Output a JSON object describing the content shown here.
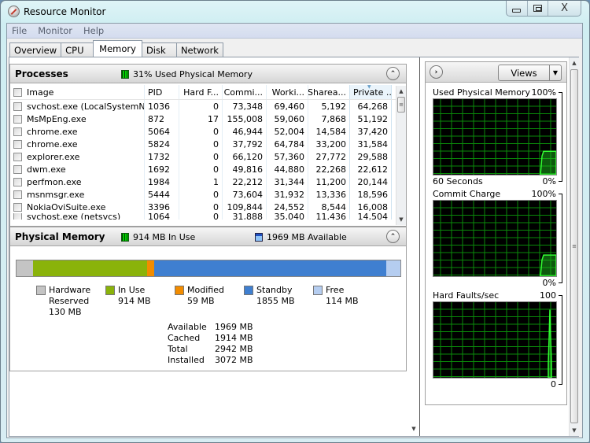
{
  "window": {
    "title": "Resource Monitor",
    "caption": {
      "minimize": "minimize",
      "maximize": "maximize",
      "close": "X"
    }
  },
  "menu": [
    "File",
    "Monitor",
    "Help"
  ],
  "tabs": [
    {
      "label": "Overview",
      "active": false
    },
    {
      "label": "CPU",
      "active": false
    },
    {
      "label": "Memory",
      "active": true
    },
    {
      "label": "Disk",
      "active": false
    },
    {
      "label": "Network",
      "active": false
    }
  ],
  "processes": {
    "title": "Processes",
    "indicator": "31% Used Physical Memory",
    "indicator_color": "#00d000",
    "columns": [
      "Image",
      "PID",
      "Hard F...",
      "Commi...",
      "Worki...",
      "Sharea...",
      "Private ..."
    ],
    "rows": [
      [
        "svchost.exe (LocalSystemNet...",
        "1036",
        "0",
        "73,348",
        "69,460",
        "5,192",
        "64,268"
      ],
      [
        "MsMpEng.exe",
        "872",
        "17",
        "155,008",
        "59,060",
        "7,868",
        "51,192"
      ],
      [
        "chrome.exe",
        "5064",
        "0",
        "46,944",
        "52,004",
        "14,584",
        "37,420"
      ],
      [
        "chrome.exe",
        "5824",
        "0",
        "37,792",
        "64,784",
        "33,200",
        "31,584"
      ],
      [
        "explorer.exe",
        "1732",
        "0",
        "66,120",
        "57,360",
        "27,772",
        "29,588"
      ],
      [
        "dwm.exe",
        "1692",
        "0",
        "49,816",
        "44,880",
        "22,268",
        "22,612"
      ],
      [
        "perfmon.exe",
        "1984",
        "1",
        "22,212",
        "31,344",
        "11,200",
        "20,144"
      ],
      [
        "msnmsgr.exe",
        "5444",
        "0",
        "73,604",
        "31,932",
        "13,336",
        "18,596"
      ],
      [
        "NokiaOviSuite.exe",
        "3396",
        "0",
        "109,844",
        "24,552",
        "8,544",
        "16,008"
      ],
      [
        "svchost.exe (netsvcs)",
        "1064",
        "0",
        "31,888",
        "35,040",
        "11,436",
        "14,504"
      ]
    ]
  },
  "physical_memory": {
    "title": "Physical Memory",
    "in_use_indicator": "914 MB In Use",
    "available_indicator": "1969 MB Available",
    "segments": [
      {
        "name": "Hardware Reserved",
        "label_lines": [
          "Hardware",
          "Reserved",
          "130 MB"
        ],
        "mb": 130,
        "color": "#c4c4c4"
      },
      {
        "name": "In Use",
        "label_lines": [
          "In Use",
          "914 MB"
        ],
        "mb": 914,
        "color": "#8ab30a"
      },
      {
        "name": "Modified",
        "label_lines": [
          "Modified",
          "59 MB"
        ],
        "mb": 59,
        "color": "#f28c00"
      },
      {
        "name": "Standby",
        "label_lines": [
          "Standby",
          "1855 MB"
        ],
        "mb": 1855,
        "color": "#3f7fd0"
      },
      {
        "name": "Free",
        "label_lines": [
          "Free",
          "114 MB"
        ],
        "mb": 114,
        "color": "#b5cdf0"
      }
    ],
    "stats": [
      {
        "label": "Available",
        "value": "1969 MB"
      },
      {
        "label": "Cached",
        "value": "1914 MB"
      },
      {
        "label": "Total",
        "value": "2942 MB"
      },
      {
        "label": "Installed",
        "value": "3072 MB"
      }
    ]
  },
  "graphs_panel": {
    "views_label": "Views",
    "graphs": [
      {
        "title": "Used Physical Memory",
        "max": "100%",
        "min": "0%",
        "footer": "60 Seconds",
        "recent_value_pct": 31
      },
      {
        "title": "Commit Charge",
        "max": "100%",
        "min": "0%",
        "footer": "",
        "recent_value_pct": 28
      },
      {
        "title": "Hard Faults/sec",
        "max": "100",
        "min": "0",
        "footer": "",
        "recent_value_pct": 90
      }
    ]
  }
}
